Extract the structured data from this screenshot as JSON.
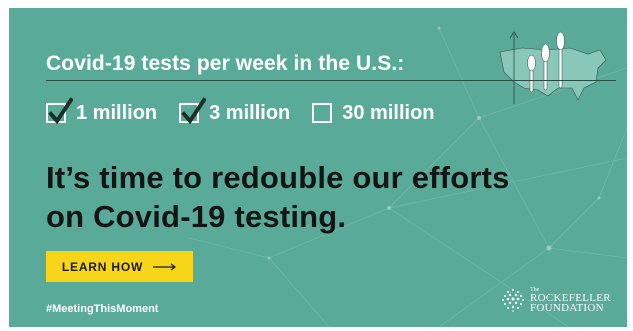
{
  "colors": {
    "background": "#5aaa9a",
    "accent_button": "#f7d61a",
    "headline_text": "#141414",
    "light_text": "#ffffff"
  },
  "header": {
    "title": "Covid-19 tests per week in the U.S.:"
  },
  "checklist": [
    {
      "label": "1 million",
      "checked": true
    },
    {
      "label": "3 million",
      "checked": true
    },
    {
      "label": "30 million",
      "checked": false
    }
  ],
  "headline": {
    "line1": "It’s time to redouble our efforts",
    "line2": "on Covid-19 testing."
  },
  "cta": {
    "label": "LEARN HOW",
    "icon": "arrow-right-icon"
  },
  "hashtag": "#MeetingThisMoment",
  "logo": {
    "the": "The",
    "line1": "ROCKEFELLER",
    "line2": "FOUNDATION",
    "icon": "globe-logo-icon"
  },
  "illustration": {
    "icon": "us-map-swab-icon"
  }
}
